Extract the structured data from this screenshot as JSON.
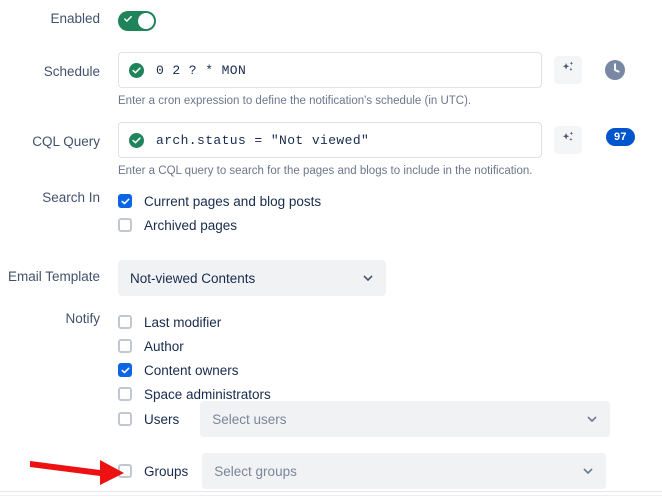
{
  "rows": {
    "enabled": {
      "label": "Enabled",
      "toggle_on": true
    },
    "schedule": {
      "label": "Schedule",
      "value": "0 2 ? * MON",
      "helper": "Enter a cron expression to define the notification's schedule (in UTC).",
      "valid": true,
      "ai_icon": "sparkle-icon",
      "clock_icon": "clock-icon"
    },
    "cql_query": {
      "label": "CQL Query",
      "value": "arch.status = \"Not viewed\"",
      "helper": "Enter a CQL query to search for the pages and blogs to include in the notification.",
      "valid": true,
      "ai_icon": "sparkle-icon",
      "badge": "97"
    },
    "search_in": {
      "label": "Search In",
      "options": [
        {
          "label": "Current pages and blog posts",
          "checked": true
        },
        {
          "label": "Archived pages",
          "checked": false
        }
      ]
    },
    "email_template": {
      "label": "Email Template",
      "value": "Not-viewed Contents"
    },
    "notify": {
      "label": "Notify",
      "options": [
        {
          "label": "Last modifier",
          "checked": false
        },
        {
          "label": "Author",
          "checked": false
        },
        {
          "label": "Content owners",
          "checked": true
        },
        {
          "label": "Space administrators",
          "checked": false
        }
      ],
      "users": {
        "label": "Users",
        "checked": false,
        "placeholder": "Select users"
      },
      "groups": {
        "label": "Groups",
        "checked": false,
        "placeholder": "Select groups"
      }
    }
  },
  "annotation": {
    "arrow_color": "#ee1111",
    "points_to": "groups-checkbox"
  },
  "colors": {
    "toggle_on": "#1f845a",
    "checkbox_checked": "#0c66e4",
    "badge": "#0055cc",
    "valid_icon": "#1f845a",
    "select_bg": "#f1f2f4",
    "input_border": "#dfe1e6",
    "label_text": "#42526e",
    "helper_text": "#6b778c"
  }
}
